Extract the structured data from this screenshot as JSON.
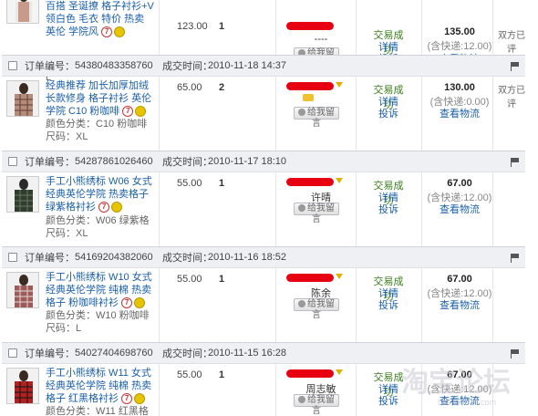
{
  "labels": {
    "order_no": "订单编号：",
    "deal_time": "成交时间：",
    "status": "交易成功",
    "details": "详情",
    "complaint": "投诉",
    "logistics": "查看物流",
    "leave_message": "给我留言",
    "rated": "双方已评"
  },
  "orders": [
    {
      "order_no": "",
      "deal_time": "",
      "title": "百搭 圣诞撩 格子衬衫+V领白色 毛衣 特价 热卖 英伦 学院风",
      "attrs": "颜色分类：图色　尺码：L",
      "price": "123.00",
      "qty": "1",
      "buyer_name": "----",
      "total": "135.00",
      "shipping": "(含快递:12.00)"
    },
    {
      "order_no": "54380483358760",
      "deal_time": "2010-11-18 14:37",
      "title": "经典推荐 加长加厚加绒 长款修身 格子衬衫 英伦学院 C10 粉咖啡",
      "attrs": "颜色分类：C10 粉咖啡　尺码：XL",
      "price": "65.00",
      "qty": "2",
      "buyer_name": "",
      "total": "130.00",
      "shipping": "(含快递:0.00)"
    },
    {
      "order_no": "54287861026460",
      "deal_time": "2010-11-17 18:10",
      "title": "手工小熊绣标 W06 女式 经典英伦学院 热卖格子 绿紫格衬衫",
      "attrs": "颜色分类：W06 绿紫格　尺码：XL",
      "price": "55.00",
      "qty": "1",
      "buyer_name": "许晴",
      "total": "67.00",
      "shipping": "(含快递:12.00)"
    },
    {
      "order_no": "54169204382060",
      "deal_time": "2010-11-16 18:52",
      "title": "手工小熊绣标 W10 女式 经典英伦学院 纯棉 热卖格子 粉咖啡衬衫",
      "attrs": "颜色分类：W10 粉咖啡　尺码：L",
      "price": "55.00",
      "qty": "1",
      "buyer_name": "陈余",
      "total": "67.00",
      "shipping": "(含快递:12.00)"
    },
    {
      "order_no": "54027404698760",
      "deal_time": "2010-11-15 16:28",
      "title": "手工小熊绣标 W11 女式 经典英伦学院 纯棉 热卖格子 红黑格衬衫",
      "attrs": "颜色分类：W11 红黑格",
      "price": "55.00",
      "qty": "1",
      "buyer_name": "周志敏",
      "total": "67.00",
      "shipping": "(含快递:12.00)"
    }
  ],
  "watermark": {
    "main": "淘宝论坛",
    "url": "bbs.taobao.com"
  },
  "colors": {
    "status_green": "#3a7d1c",
    "link_blue": "#1a5fa8",
    "redact_red": "#e60012",
    "header_bg": "#eef0f3"
  },
  "icons": [
    "checkbox-icon",
    "flag-icon",
    "seven-day-return-icon",
    "guarantee-icon",
    "message-icon",
    "star-icon"
  ]
}
